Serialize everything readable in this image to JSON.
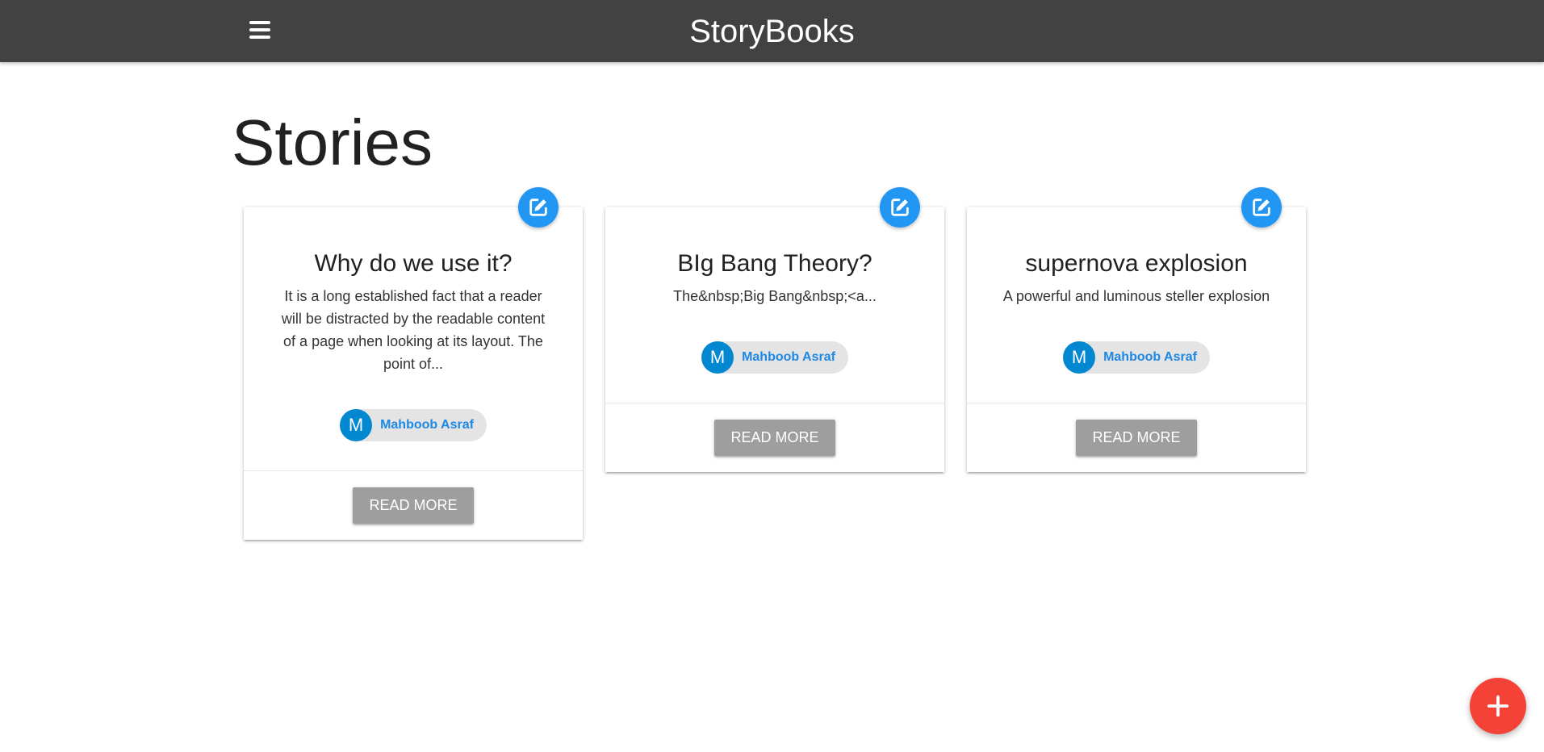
{
  "navbar": {
    "brand": "StoryBooks",
    "menu_icon": "hamburger-menu-icon",
    "background": "#424242"
  },
  "page": {
    "title": "Stories"
  },
  "stories": [
    {
      "title": "Why do we use it?",
      "excerpt": "It is a long established fact that a reader will be distracted by the readable content of a page when looking at its layout. The point of...",
      "author_initial": "M",
      "author_name": "Mahboob Asraf",
      "read_more_label": "READ MORE",
      "edit_icon": "edit-icon"
    },
    {
      "title": "BIg Bang Theory?",
      "excerpt": "The&nbsp;Big Bang&nbsp;<a...",
      "author_initial": "M",
      "author_name": "Mahboob Asraf",
      "read_more_label": "READ MORE",
      "edit_icon": "edit-icon"
    },
    {
      "title": "supernova explosion",
      "excerpt": "A powerful and luminous steller explosion",
      "author_initial": "M",
      "author_name": "Mahboob Asraf",
      "read_more_label": "READ MORE",
      "edit_icon": "edit-icon"
    }
  ],
  "add_button": {
    "icon": "plus-icon",
    "color": "#f44336"
  },
  "colors": {
    "edit_fab": "#2196f3",
    "avatar": "#0288d1",
    "author_link": "#1e88e5",
    "read_more_button": "#9e9e9e"
  }
}
